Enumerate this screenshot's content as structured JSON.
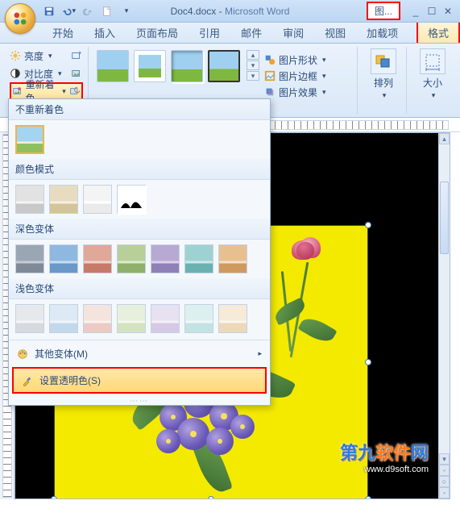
{
  "title": {
    "doc": "Doc4.docx",
    "sep": " - ",
    "app": "Microsoft Word"
  },
  "contextual_tab_group": "图...",
  "tabs": {
    "items": [
      "开始",
      "插入",
      "页面布局",
      "引用",
      "邮件",
      "审阅",
      "视图",
      "加载项"
    ],
    "contextual": "格式",
    "active_index": 8
  },
  "ribbon": {
    "adjust": {
      "brightness": "亮度",
      "contrast": "对比度",
      "recolor": "重新着色"
    },
    "picture_options": {
      "shape": "图片形状",
      "border": "图片边框",
      "effects": "图片效果"
    },
    "arrange": "排列",
    "size": "大小"
  },
  "recolor_menu": {
    "no_recolor_header": "不重新着色",
    "color_modes_header": "颜色模式",
    "dark_variants_header": "深色变体",
    "light_variants_header": "浅色变体",
    "more_variations": "其他变体(M)",
    "set_transparent": "设置透明色(S)",
    "dark_colors": [
      {
        "sky": "#9aa6b4",
        "sand": "#c8cbd0",
        "gr": "#7e8a98"
      },
      {
        "sky": "#8fb8e0",
        "sand": "#c9ddf0",
        "gr": "#6a98c8"
      },
      {
        "sky": "#e0a898",
        "sand": "#f0d2c9",
        "gr": "#c87a68"
      },
      {
        "sky": "#b8cf9a",
        "sand": "#dce9cb",
        "gr": "#8fb06a"
      },
      {
        "sky": "#b8a8d4",
        "sand": "#dcd2ea",
        "gr": "#9080b8"
      },
      {
        "sky": "#9ed2d2",
        "sand": "#cde9e9",
        "gr": "#6ab2b2"
      },
      {
        "sky": "#e8c090",
        "sand": "#f4e0c9",
        "gr": "#cf9a60"
      }
    ],
    "light_colors": [
      {
        "sky": "#e6e9ec",
        "sand": "#f3f4f6",
        "gr": "#d5dae0"
      },
      {
        "sky": "#dde9f5",
        "sand": "#eff5fb",
        "gr": "#c4d8ec"
      },
      {
        "sky": "#f5e3de",
        "sand": "#fbf2ef",
        "gr": "#eccbc3"
      },
      {
        "sky": "#e7f0dc",
        "sand": "#f3f8ec",
        "gr": "#d3e3bf"
      },
      {
        "sky": "#e8e1f1",
        "sand": "#f3eff8",
        "gr": "#d5c9e6"
      },
      {
        "sky": "#ddf0f0",
        "sand": "#eff8f8",
        "gr": "#c3e3e3"
      },
      {
        "sky": "#f6ead9",
        "sand": "#fbf5ec",
        "gr": "#edd8ba"
      }
    ]
  },
  "watermark": {
    "line1_a": "第九",
    "line1_b": "软件",
    "line1_c": "网",
    "line2": "www.d9soft.com"
  }
}
